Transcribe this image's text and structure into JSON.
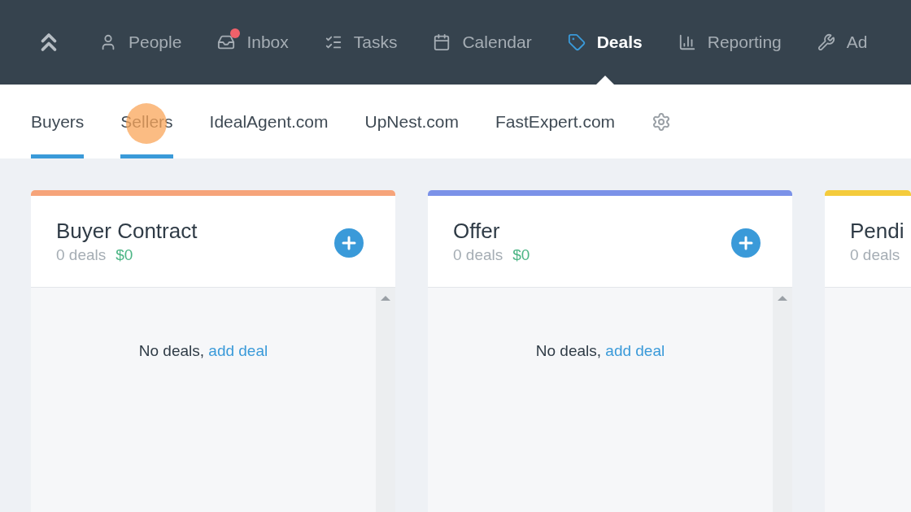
{
  "nav": {
    "items": [
      {
        "label": "People",
        "selected": false,
        "notification": false
      },
      {
        "label": "Inbox",
        "selected": false,
        "notification": true
      },
      {
        "label": "Tasks",
        "selected": false,
        "notification": false
      },
      {
        "label": "Calendar",
        "selected": false,
        "notification": false
      },
      {
        "label": "Deals",
        "selected": true,
        "notification": false
      },
      {
        "label": "Reporting",
        "selected": false,
        "notification": false
      },
      {
        "label": "Ad",
        "selected": false,
        "notification": false
      }
    ]
  },
  "tabs": [
    {
      "label": "Buyers",
      "selected": true
    },
    {
      "label": "Sellers",
      "selected": true
    },
    {
      "label": "IdealAgent.com",
      "selected": false
    },
    {
      "label": "UpNest.com",
      "selected": false
    },
    {
      "label": "FastExpert.com",
      "selected": false
    }
  ],
  "columns": [
    {
      "kind": "full",
      "title": "Buyer Contract",
      "count": "0 deals",
      "value": "$0",
      "color": "#f6a47a",
      "empty_text": "No deals,",
      "empty_link": "add deal"
    },
    {
      "kind": "full",
      "title": "Offer",
      "count": "0 deals",
      "value": "$0",
      "color": "#7b92e8",
      "empty_text": "No deals,",
      "empty_link": "add deal"
    },
    {
      "kind": "partial",
      "title": "Pendi",
      "count": "0 deals",
      "color": "#f4cb3c"
    }
  ]
}
